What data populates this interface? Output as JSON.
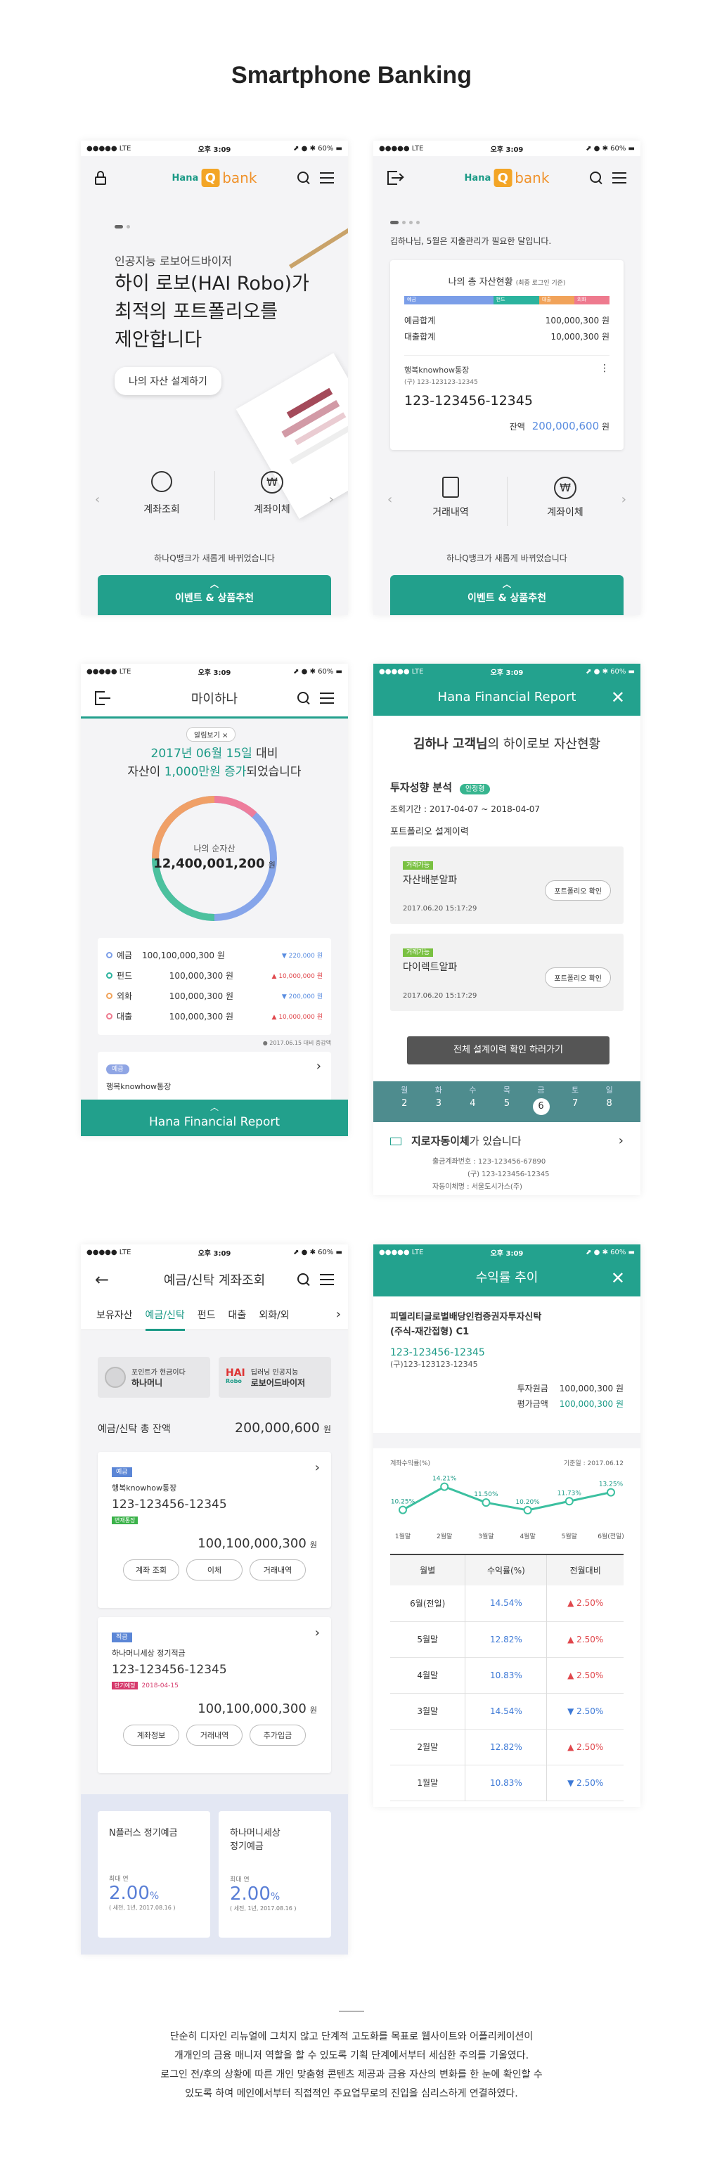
{
  "page_title": "Smartphone Banking",
  "status": {
    "left": "●●●●● LTE",
    "center": "오후 3:09",
    "right": "⬈ ● ✱ 60% ▬"
  },
  "logo": {
    "hana": "Hana",
    "q": "Q",
    "bank": "bank"
  },
  "s1": {
    "subtitle": "인공지능 로보어드바이저",
    "headline1": "하이 로보(HAI Robo)가",
    "headline2": "최적의 포트폴리오를",
    "headline3": "제안합니다",
    "cta": "나의 자산 설계하기",
    "q1": "계좌조회",
    "q2": "계좌이체",
    "notice": "하나Q뱅크가 새롭게 바뀌었습니다",
    "bottom": "이벤트 & 상품추천"
  },
  "s2": {
    "greeting": "김하나님, 5월은 지출관리가 필요한 달입니다.",
    "card_title": "나의 총 자산현황",
    "card_sub": "(최종 로그인 기준)",
    "bar_labels": [
      "예금",
      "펀드",
      "대출",
      "외화"
    ],
    "dep_label": "예금합계",
    "dep_value": "100,000,300 원",
    "loan_label": "대출합계",
    "loan_value": "10,000,300 원",
    "acct_name": "행복knowhow통장",
    "acct_old": "(구) 123-123123-12345",
    "acct_no": "123-123456-12345",
    "bal_label": "잔액",
    "bal_value": "200,000,600",
    "bal_unit": "원",
    "q1": "거래내역",
    "q2": "계좌이체",
    "notice": "하나Q뱅크가 새롭게 바뀌었습니다",
    "bottom": "이벤트 & 상품추천"
  },
  "s3": {
    "title": "마이하나",
    "toggle": "알림보기 ×",
    "line1a": "2017년 06월 15일",
    "line1b": " 대비",
    "line2a": "자산이 ",
    "line2b": "1,000만원 증가",
    "line2c": "되었습니다",
    "donut_label": "나의 순자산",
    "donut_value": "12,400,001,200",
    "donut_unit": "원",
    "rows": [
      {
        "name": "예금",
        "value": "100,100,000,300 원",
        "delta": "▼ 220,000 원"
      },
      {
        "name": "펀드",
        "value": "100,000,300 원",
        "delta": "▲ 10,000,000 원"
      },
      {
        "name": "외화",
        "value": "100,000,300 원",
        "delta": "▼ 200,000 원"
      },
      {
        "name": "대출",
        "value": "100,000,300 원",
        "delta": "▲ 10,000,000 원"
      }
    ],
    "basis": "● 2017.06.15 대비 증감액",
    "chip": "예금",
    "acct_name": "행복knowhow통장",
    "bottom": "Hana Financial Report"
  },
  "s4": {
    "header": "Hana Financial Report",
    "title_name": "김하나 고객님",
    "title_rest": "의 하이로보 자산현황",
    "section": "투자성향 분석",
    "badge": "안정형",
    "period": "조회기간 : 2017-04-07 ~ 2018-04-07",
    "history": "포트폴리오 설계이력",
    "items": [
      {
        "tag": "거래가능",
        "name": "자산배분알파",
        "date": "2017.06.20 15:17:29",
        "btn": "포트폴리오 확인"
      },
      {
        "tag": "거래가능",
        "name": "다이렉트알파",
        "date": "2017.06.20 15:17:29",
        "btn": "포트폴리오 확인"
      }
    ],
    "all_btn": "전체 설계이력 확인 하러가기",
    "days": [
      "월",
      "화",
      "수",
      "목",
      "금",
      "토",
      "일"
    ],
    "dates": [
      "2",
      "3",
      "4",
      "5",
      "6",
      "7",
      "8"
    ],
    "notice_bold": "지로자동이체",
    "notice_rest": "가 있습니다",
    "notice_l1": "출금계좌번호 : 123-123456-67890",
    "notice_l2": "(구) 123-123456-12345",
    "notice_l3": "자동이체명 : 서울도시가스(주)"
  },
  "s5": {
    "title": "예금/신탁 계좌조회",
    "tabs": [
      "보유자산",
      "예금/신탁",
      "펀드",
      "대출",
      "외화/외"
    ],
    "promo1a": "포인트가 현금이다",
    "promo1b": "하나머니",
    "promo2a": "딥러닝 인공지능",
    "promo2b": "로보어드바이저",
    "total_label": "예금/신탁 총 잔액",
    "total_value": "200,000,600",
    "total_unit": "원",
    "acc1": {
      "chip": "예금",
      "name": "행복knowhow통장",
      "no": "123-123456-12345",
      "tag": "변재통장",
      "bal": "100,100,000,300",
      "unit": "원",
      "btns": [
        "계좌 조회",
        "이체",
        "거래내역"
      ]
    },
    "acc2": {
      "chip": "적금",
      "name": "하나머니세상 정기적금",
      "no": "123-123456-12345",
      "tag": "만기예정",
      "due": "2018-04-15",
      "bal": "100,100,000,300",
      "unit": "원",
      "btns": [
        "계좌정보",
        "거래내역",
        "추가입금"
      ]
    },
    "prod1": {
      "name": "N플러스 정기예금",
      "rate_label": "최대 연",
      "rate": "2.00",
      "pct": "%",
      "note": "( 세전, 1년, 2017.08.16 )"
    },
    "prod2": {
      "name1": "하나머니세상",
      "name2": "정기예금",
      "rate_label": "최대 연",
      "rate": "2.00",
      "pct": "%",
      "note": "( 세전, 1년, 2017.08.16 )"
    }
  },
  "s6": {
    "header": "수익률 추이",
    "fund1": "피델리티글로벌배당인컴증권자투자신탁",
    "fund2": "(주식-재간접형) C1",
    "acct": "123-123456-12345",
    "acct_old": "(구)123-123123-12345",
    "inv_label": "투자원금",
    "inv_value": "100,000,300 원",
    "eval_label": "평가금액",
    "eval_value": "100,000,300 원",
    "chart_label": "계좌수익률(%)",
    "chart_basis": "기준일 : 2017.06.12",
    "table_head": [
      "월별",
      "수익률(%)",
      "전월대비"
    ],
    "table_rows": [
      {
        "m": "6월(전일)",
        "r": "14.54%",
        "d": "▲ 2.50%",
        "up": true
      },
      {
        "m": "5월말",
        "r": "12.82%",
        "d": "▲ 2.50%",
        "up": true
      },
      {
        "m": "4월말",
        "r": "10.83%",
        "d": "▲ 2.50%",
        "up": true
      },
      {
        "m": "3월말",
        "r": "14.54%",
        "d": "▼ 2.50%",
        "up": false
      },
      {
        "m": "2월말",
        "r": "12.82%",
        "d": "▲ 2.50%",
        "up": true
      },
      {
        "m": "1월말",
        "r": "10.83%",
        "d": "▼ 2.50%",
        "up": false
      }
    ]
  },
  "chart_data": {
    "type": "line",
    "categories": [
      "1월말",
      "2월말",
      "3월말",
      "4월말",
      "5월말",
      "6월(전일)"
    ],
    "values": [
      10.25,
      14.21,
      11.5,
      10.2,
      11.73,
      13.25
    ],
    "labels": [
      "10.25%",
      "14.21%",
      "11.50%",
      "10.20%",
      "11.73%",
      "13.25%"
    ],
    "ylabel": "계좌수익률(%)",
    "ylim": [
      9,
      15
    ]
  },
  "description": [
    "단순히 디자인 리뉴얼에 그치지 않고 단계적 고도화를 목표로 웹사이트와 어플리케이션이",
    "개개인의 금융 매니저 역할을 할 수 있도록 기획 단계에서부터 세심한 주의를 기울였다.",
    "로그인 전/후의 상황에 따른 개인 맞춤형 콘텐츠 제공과 금융 자산의 변화를 한 눈에 확인할 수",
    "있도록 하여 메인에서부터 직접적인 주요업무로의 진입을 심리스하게 연결하였다."
  ]
}
